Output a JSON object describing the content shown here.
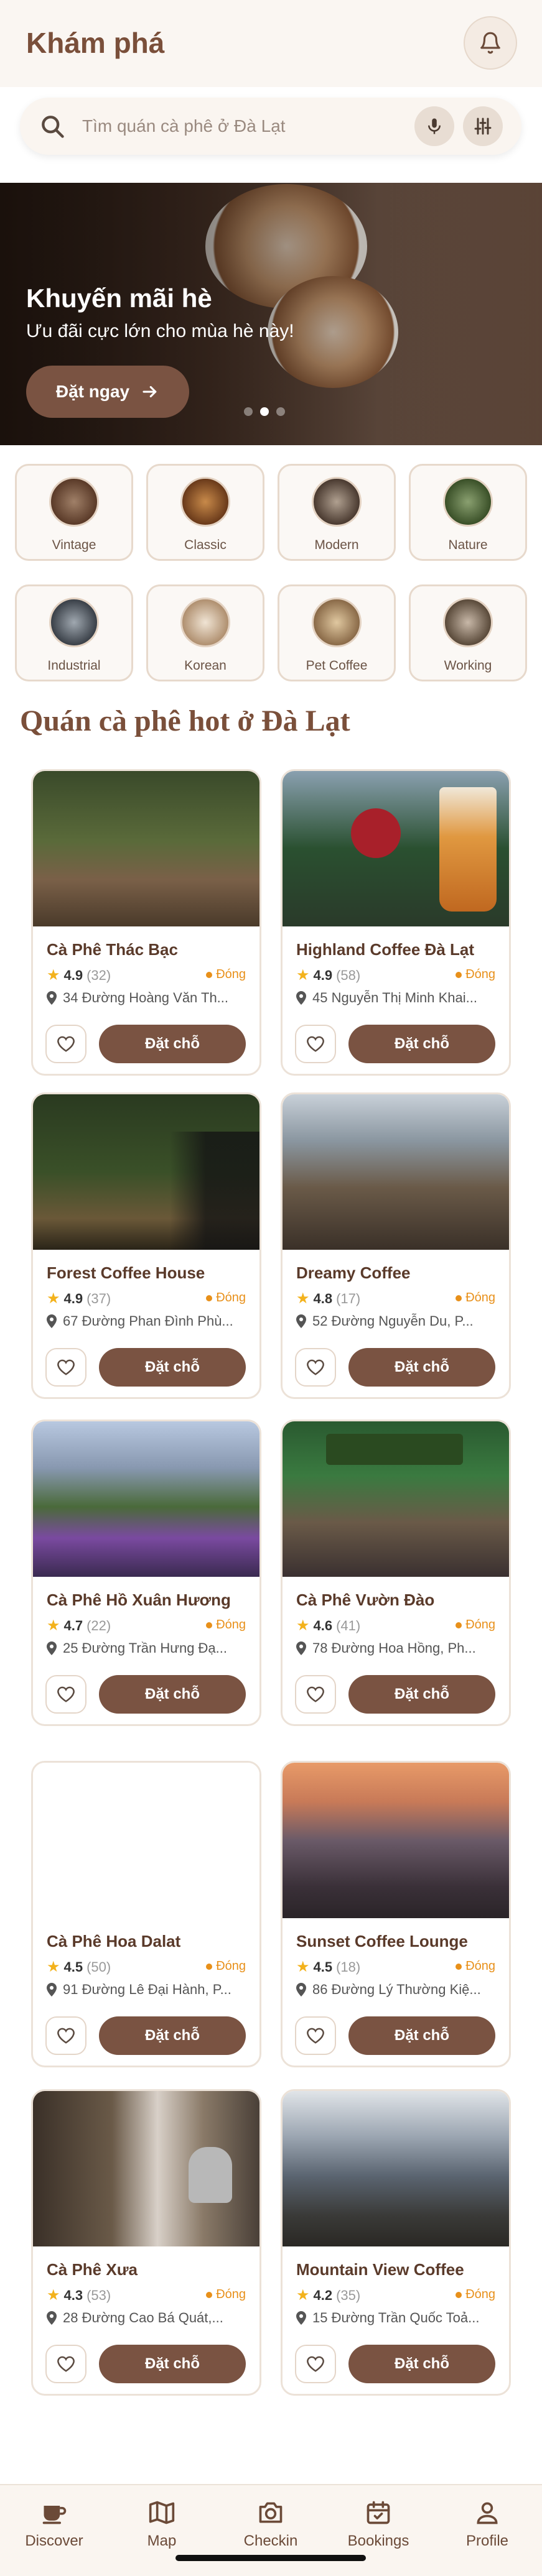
{
  "header": {
    "title": "Khám phá",
    "bell_icon": "bell-icon"
  },
  "search": {
    "placeholder": "Tìm quán cà phê ở Đà Lạt",
    "mic_icon": "mic-icon",
    "filter_icon": "sliders-icon"
  },
  "banner": {
    "title": "Khuyến mãi hè",
    "subtitle": "Ưu đãi cực lớn cho mùa hè này!",
    "button_label": "Đặt ngay",
    "slides": 3,
    "active_slide": 2
  },
  "categories": [
    {
      "label": "Vintage"
    },
    {
      "label": "Classic"
    },
    {
      "label": "Modern"
    },
    {
      "label": "Nature"
    },
    {
      "label": "Industrial"
    },
    {
      "label": "Korean"
    },
    {
      "label": "Pet Coffee"
    },
    {
      "label": "Working"
    }
  ],
  "section": {
    "title": "Quán cà phê hot ở Đà Lạt"
  },
  "cafes": [
    {
      "name": "Cà Phê Thác Bạc",
      "rating": "4.9",
      "count": "(32)",
      "status": "Đóng",
      "address": "34 Đường Hoàng Văn Th...",
      "book_label": "Đặt chỗ"
    },
    {
      "name": "Highland Coffee Đà Lạt",
      "rating": "4.9",
      "count": "(58)",
      "status": "Đóng",
      "address": "45 Nguyễn Thị Minh Khai...",
      "book_label": "Đặt chỗ"
    },
    {
      "name": "Forest Coffee House",
      "rating": "4.9",
      "count": "(37)",
      "status": "Đóng",
      "address": "67 Đường Phan Đình Phù...",
      "book_label": "Đặt chỗ"
    },
    {
      "name": "Dreamy Coffee",
      "rating": "4.8",
      "count": "(17)",
      "status": "Đóng",
      "address": "52 Đường Nguyễn Du, P...",
      "book_label": "Đặt chỗ"
    },
    {
      "name": "Cà Phê Hồ Xuân Hương",
      "rating": "4.7",
      "count": "(22)",
      "status": "Đóng",
      "address": "25 Đường Trần Hưng Đạ...",
      "book_label": "Đặt chỗ"
    },
    {
      "name": "Cà Phê Vườn Đào",
      "rating": "4.6",
      "count": "(41)",
      "status": "Đóng",
      "address": "78 Đường Hoa Hồng, Ph...",
      "book_label": "Đặt chỗ"
    },
    {
      "name": "Cà Phê Hoa Dalat",
      "rating": "4.5",
      "count": "(50)",
      "status": "Đóng",
      "address": "91 Đường Lê Đại Hành, P...",
      "book_label": "Đặt chỗ"
    },
    {
      "name": "Sunset Coffee Lounge",
      "rating": "4.5",
      "count": "(18)",
      "status": "Đóng",
      "address": "86 Đường Lý Thường Kiệ...",
      "book_label": "Đặt chỗ"
    },
    {
      "name": "Cà Phê Xưa",
      "rating": "4.3",
      "count": "(53)",
      "status": "Đóng",
      "address": "28 Đường Cao Bá Quát,...",
      "book_label": "Đặt chỗ"
    },
    {
      "name": "Mountain View Coffee",
      "rating": "4.2",
      "count": "(35)",
      "status": "Đóng",
      "address": "15 Đường Trần Quốc Toả...",
      "book_label": "Đặt chỗ"
    }
  ],
  "bottom_nav": [
    {
      "label": "Discover",
      "icon": "coffee-cup-icon"
    },
    {
      "label": "Map",
      "icon": "map-icon"
    },
    {
      "label": "Checkin",
      "icon": "camera-icon"
    },
    {
      "label": "Bookings",
      "icon": "calendar-check-icon"
    },
    {
      "label": "Profile",
      "icon": "user-icon"
    }
  ],
  "colors": {
    "brand": "#7a4f3a",
    "button": "#7a5342",
    "status_closed": "#e8901a",
    "star": "#f3b21c"
  }
}
